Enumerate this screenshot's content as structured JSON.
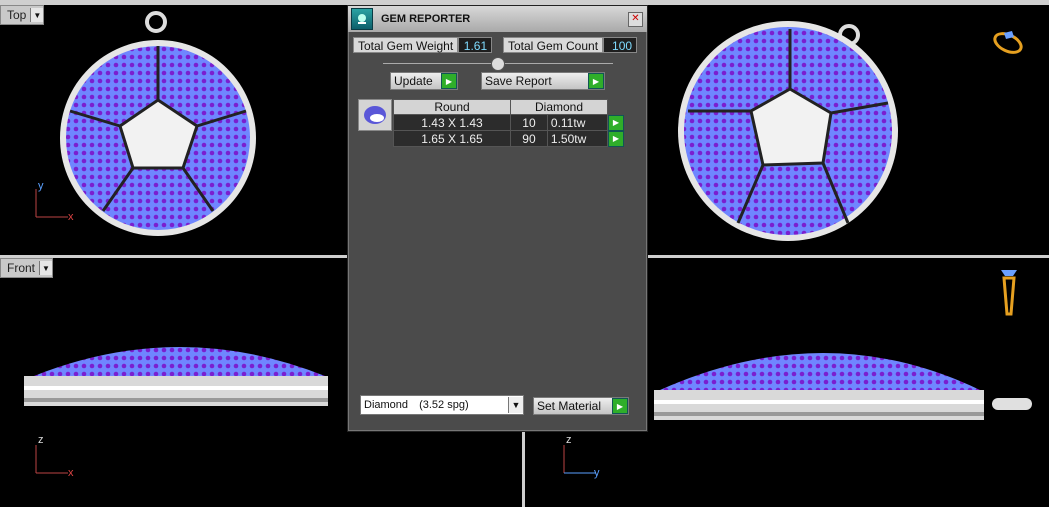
{
  "viewports": {
    "top": {
      "label": "Top"
    },
    "front": {
      "label": "Front"
    }
  },
  "axes": {
    "top": [
      "y",
      "x"
    ],
    "front": [
      "z",
      "x"
    ],
    "right": [
      "z",
      "y"
    ]
  },
  "panel": {
    "title": "GEM REPORTER",
    "close_icon": "close-icon",
    "total_weight_label": "Total Gem Weight",
    "total_weight_value": "1.61",
    "total_count_label": "Total Gem Count",
    "total_count_value": "100",
    "update_label": "Update",
    "save_report_label": "Save Report",
    "table": {
      "headers": [
        "Round",
        "Diamond"
      ],
      "rows": [
        {
          "size": "1.43 X 1.43",
          "count": "10",
          "weight": "0.11tw"
        },
        {
          "size": "1.65 X 1.65",
          "count": "90",
          "weight": "1.50tw"
        }
      ]
    },
    "material_select": {
      "value": "Diamond",
      "spg": "(3.52 spg)"
    },
    "set_material_label": "Set Material"
  },
  "colors": {
    "accent_green": "#2fae2a",
    "value_cyan": "#7fdcff",
    "gem_light": "#8fa3ff",
    "gem_purple": "#6a14b5"
  }
}
